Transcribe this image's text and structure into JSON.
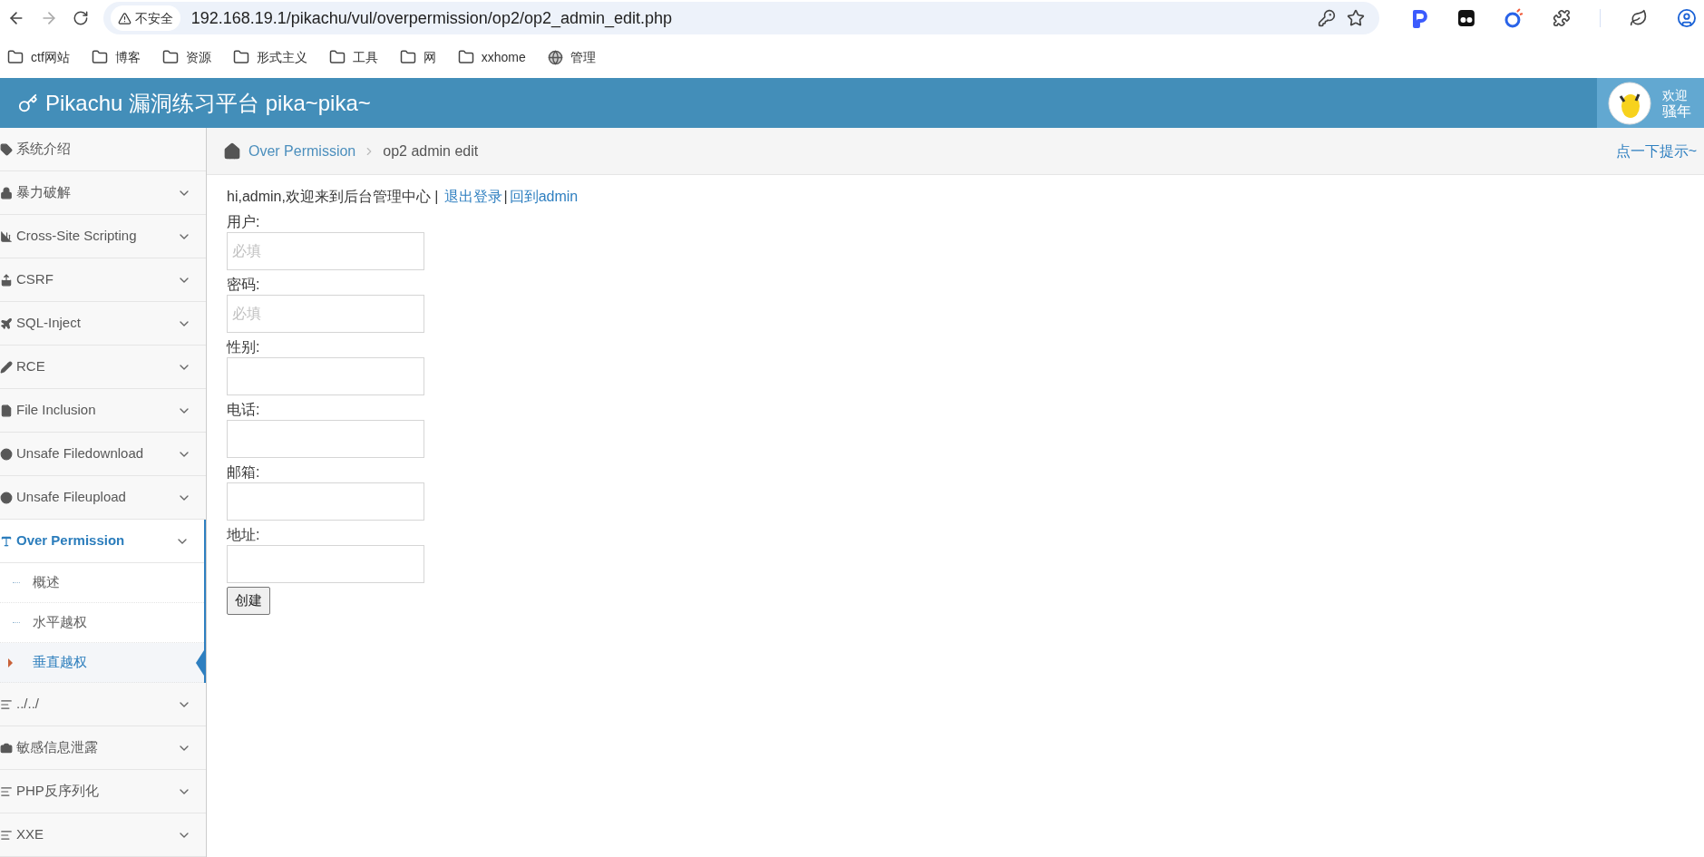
{
  "browser": {
    "security": "不安全",
    "url": "192.168.19.1/pikachu/vul/overpermission/op2/op2_admin_edit.php",
    "bookmarks": [
      {
        "label": "ctf网站",
        "kind": "folder"
      },
      {
        "label": "博客",
        "kind": "folder"
      },
      {
        "label": "资源",
        "kind": "folder"
      },
      {
        "label": "形式主义",
        "kind": "folder"
      },
      {
        "label": "工具",
        "kind": "folder"
      },
      {
        "label": "网",
        "kind": "folder"
      },
      {
        "label": "xxhome",
        "kind": "folder"
      },
      {
        "label": "管理",
        "kind": "globe"
      }
    ]
  },
  "header": {
    "title": "Pikachu 漏洞练习平台 pika~pika~",
    "user": {
      "greeting": "欢迎",
      "name": "骚年"
    }
  },
  "sidebar": {
    "items": [
      {
        "label": "系统介绍",
        "kind": "link",
        "expanded": false
      },
      {
        "label": "暴力破解",
        "kind": "menu",
        "expanded": false
      },
      {
        "label": "Cross-Site Scripting",
        "kind": "menu",
        "expanded": false
      },
      {
        "label": "CSRF",
        "kind": "menu",
        "expanded": false
      },
      {
        "label": "SQL-Inject",
        "kind": "menu",
        "expanded": false
      },
      {
        "label": "RCE",
        "kind": "menu",
        "expanded": false
      },
      {
        "label": "File Inclusion",
        "kind": "menu",
        "expanded": false
      },
      {
        "label": "Unsafe Filedownload",
        "kind": "menu",
        "expanded": false
      },
      {
        "label": "Unsafe Fileupload",
        "kind": "menu",
        "expanded": false
      },
      {
        "label": "Over Permission",
        "kind": "menu",
        "expanded": true,
        "children": [
          {
            "label": "概述",
            "selected": false
          },
          {
            "label": "水平越权",
            "selected": false
          },
          {
            "label": "垂直越权",
            "selected": true
          }
        ]
      },
      {
        "label": "../../",
        "kind": "menu",
        "expanded": false
      },
      {
        "label": "敏感信息泄露",
        "kind": "menu",
        "expanded": false
      },
      {
        "label": "PHP反序列化",
        "kind": "menu",
        "expanded": false
      },
      {
        "label": "XXE",
        "kind": "menu",
        "expanded": false
      }
    ]
  },
  "breadcrumb": {
    "items": [
      "Over Permission",
      "op2 admin edit"
    ],
    "hint": "点一下提示~"
  },
  "content": {
    "greeting": "hi,admin,欢迎来到后台管理中心 |",
    "links": [
      "退出登录",
      "回到admin"
    ],
    "separator": "|",
    "fields": [
      {
        "label": "用户:",
        "placeholder": "必填"
      },
      {
        "label": "密码:",
        "placeholder": "必填"
      },
      {
        "label": "性别:"
      },
      {
        "label": "电话:"
      },
      {
        "label": "邮箱:"
      },
      {
        "label": "地址:"
      }
    ],
    "submit": "创建"
  }
}
